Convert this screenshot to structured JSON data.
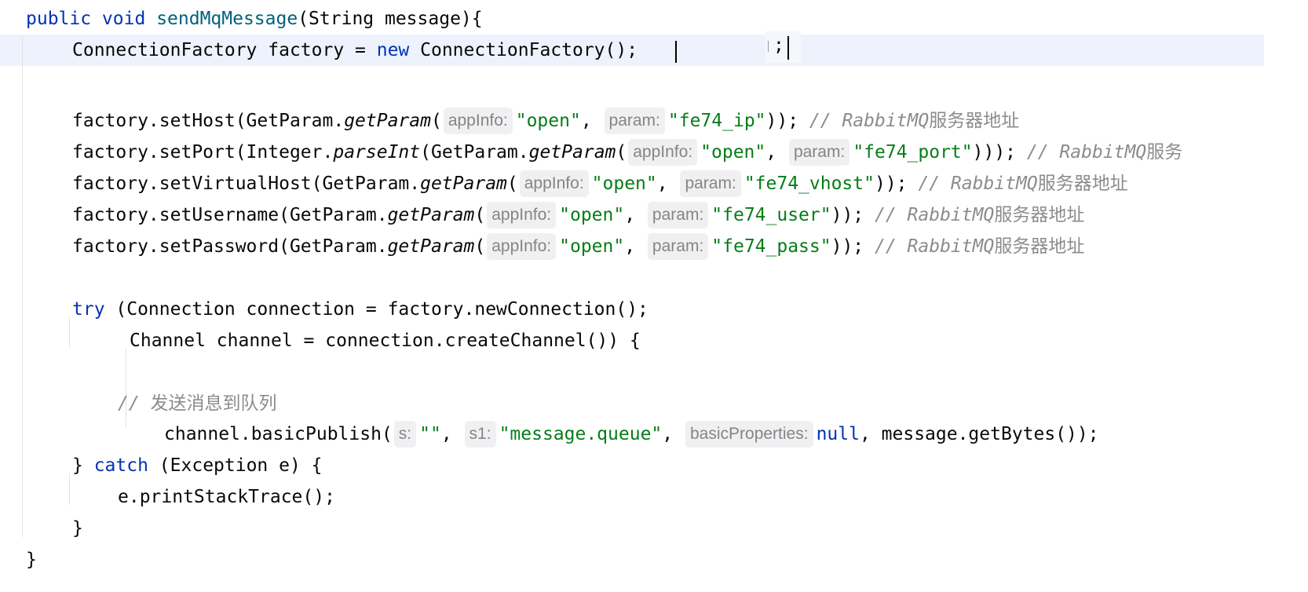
{
  "editor": {
    "language": "java",
    "method": {
      "modifiers": "public void",
      "name": "sendMqMessage",
      "params": "(String message){"
    },
    "factory_decl": {
      "type": "ConnectionFactory factory = ",
      "kw_new": "new",
      "ctor": " ConnectionFactory();",
      "stray_semicolon": ";"
    },
    "setters": [
      {
        "pre": "factory.setHost(GetParam.",
        "fn": "getParam",
        "open": "(",
        "hint1": "appInfo:",
        "arg1": "\"open\"",
        "sep": ", ",
        "hint2": "param:",
        "arg2": "\"fe74_ip\"",
        "close": ")); ",
        "comment": "// RabbitMQ",
        "comment_cjk": "服务器地址"
      },
      {
        "pre": "factory.setPort(Integer.",
        "fn0": "parseInt",
        "mid": "(GetParam.",
        "fn": "getParam",
        "open": "(",
        "hint1": "appInfo:",
        "arg1": "\"open\"",
        "sep": ", ",
        "hint2": "param:",
        "arg2": "\"fe74_port\"",
        "close": "))); ",
        "comment": "// RabbitMQ",
        "comment_cjk": "服务"
      },
      {
        "pre": "factory.setVirtualHost(GetParam.",
        "fn": "getParam",
        "open": "(",
        "hint1": "appInfo:",
        "arg1": "\"open\"",
        "sep": ", ",
        "hint2": "param:",
        "arg2": "\"fe74_vhost\"",
        "close": ")); ",
        "comment": "// RabbitMQ",
        "comment_cjk": "服务器地址"
      },
      {
        "pre": "factory.setUsername(GetParam.",
        "fn": "getParam",
        "open": "(",
        "hint1": "appInfo:",
        "arg1": "\"open\"",
        "sep": ", ",
        "hint2": "param:",
        "arg2": "\"fe74_user\"",
        "close": ")); ",
        "comment": "// RabbitMQ",
        "comment_cjk": "服务器地址"
      },
      {
        "pre": "factory.setPassword(GetParam.",
        "fn": "getParam",
        "open": "(",
        "hint1": "appInfo:",
        "arg1": "\"open\"",
        "sep": ", ",
        "hint2": "param:",
        "arg2": "\"fe74_pass\"",
        "close": ")); ",
        "comment": "// RabbitMQ",
        "comment_cjk": "服务器地址"
      }
    ],
    "try_kw": "try",
    "try_rest": " (Connection connection = factory.newConnection();",
    "channel_line": "Channel channel = connection.createChannel()) {",
    "send_comment": "// ",
    "send_comment_cjk": "发送消息到队列",
    "publish": {
      "pre": "channel.basicPublish(",
      "hint_s": "s:",
      "arg_s": "\"\"",
      "sep1": ", ",
      "hint_s1": "s1:",
      "arg_s1": "\"message.queue\"",
      "sep2": ", ",
      "hint_props": "basicProperties:",
      "arg_null": "null",
      "rest": ", message.getBytes());"
    },
    "catch_open": "} ",
    "catch_kw": "catch",
    "catch_rest": " (Exception e) {",
    "stack_trace": "e.printStackTrace();",
    "close_brace": "}",
    "method_close": "}"
  }
}
